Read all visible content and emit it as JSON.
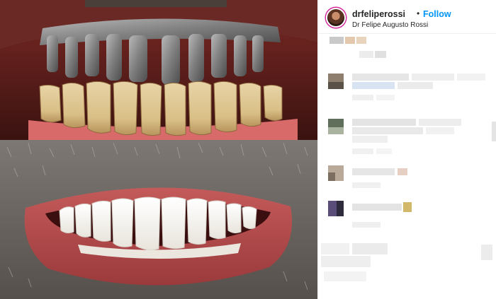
{
  "post": {
    "username": "drfeliperossi",
    "separator": "•",
    "follow_label": "Follow",
    "subtitle": "Dr Felipe Augusto Rossi",
    "photo_top_icon": "metal-framework-teeth-photo",
    "photo_bottom_icon": "finished-smile-photo"
  },
  "colors": {
    "follow": "#0095f6",
    "username": "#262626",
    "story_ring": "#d6249f"
  }
}
